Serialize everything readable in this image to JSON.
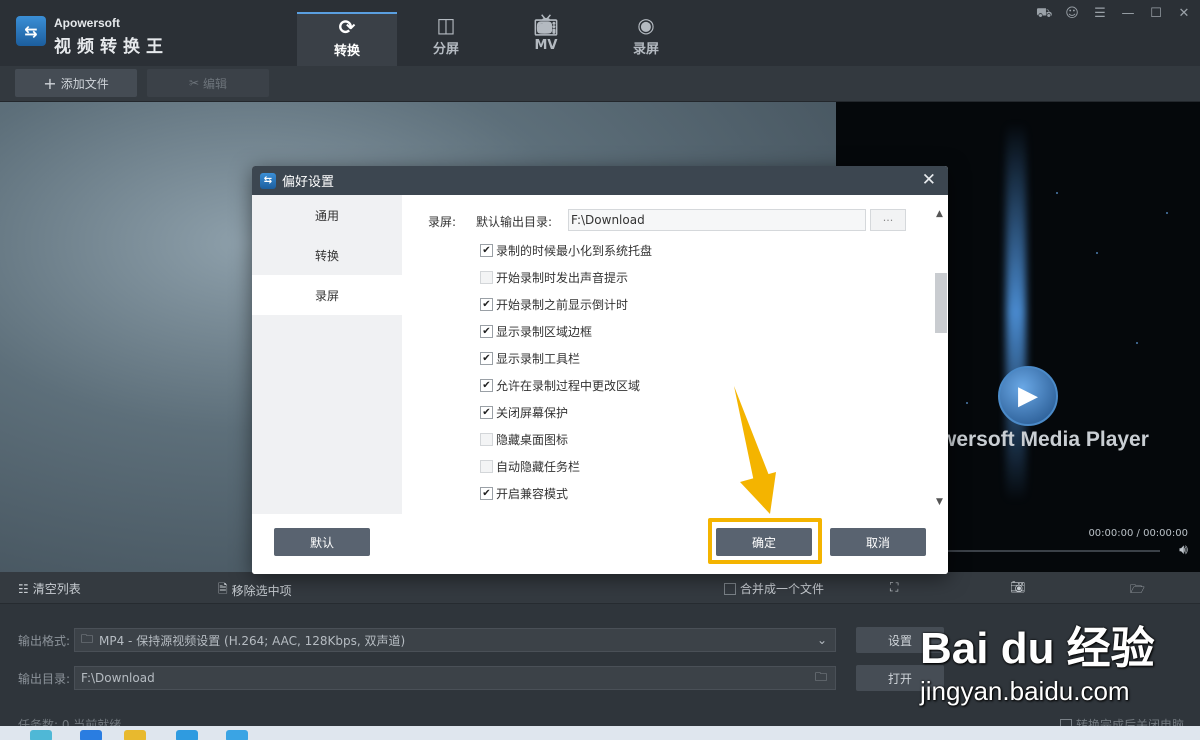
{
  "app": {
    "brand_en": "Apowersoft",
    "brand_cn": "视频转换王"
  },
  "tabs": [
    {
      "label": "转换",
      "icon": "refresh-icon",
      "active": true
    },
    {
      "label": "分屏",
      "icon": "split-screen-icon",
      "active": false
    },
    {
      "label": "MV",
      "icon": "tv-icon",
      "active": false
    },
    {
      "label": "录屏",
      "icon": "record-icon",
      "active": false
    }
  ],
  "toolbar": {
    "add_file": "添加文件",
    "edit": "编辑"
  },
  "player": {
    "name": "wersoft Media Player",
    "time": "00:00:00 / 00:00:00"
  },
  "bottom": {
    "clear_list": "清空列表",
    "remove_selected": "移除选中项",
    "merge": "合并成一个文件",
    "format_label": "输出格式:",
    "format_value": "MP4 - 保持源视频设置 (H.264; AAC, 128Kbps, 双声道)",
    "dir_label": "输出目录:",
    "dir_value": "F:\\Download",
    "settings_btn": "设置",
    "open_btn": "打开",
    "status": "任务数: 0    当前就绪",
    "shutdown": "转换完成后关闭电脑"
  },
  "dialog": {
    "title": "偏好设置",
    "sidebar": [
      "通用",
      "转换",
      "录屏"
    ],
    "active_section": "录屏",
    "section_label": "录屏:",
    "default_dir_label": "默认输出目录:",
    "default_dir_value": "F:\\Download",
    "browse": "···",
    "options": [
      {
        "label": "录制的时候最小化到系统托盘",
        "checked": true
      },
      {
        "label": "开始录制时发出声音提示",
        "checked": false
      },
      {
        "label": "开始录制之前显示倒计时",
        "checked": true
      },
      {
        "label": "显示录制区域边框",
        "checked": true
      },
      {
        "label": "显示录制工具栏",
        "checked": true
      },
      {
        "label": "允许在录制过程中更改区域",
        "checked": true
      },
      {
        "label": "关闭屏幕保护",
        "checked": true
      },
      {
        "label": "隐藏桌面图标",
        "checked": false
      },
      {
        "label": "自动隐藏任务栏",
        "checked": false
      },
      {
        "label": "开启兼容模式",
        "checked": true
      }
    ],
    "default_btn": "默认",
    "ok_btn": "确定",
    "cancel_btn": "取消"
  },
  "watermark": {
    "brand": "Bai du 经验",
    "url": "jingyan.baidu.com"
  },
  "colors": {
    "highlight": "#f4b400",
    "dialog_header": "#3c4650",
    "button": "#596370"
  }
}
